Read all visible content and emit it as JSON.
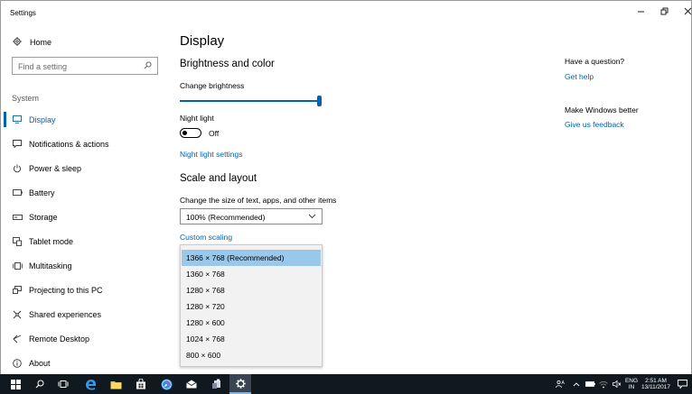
{
  "window": {
    "title": "Settings"
  },
  "sidebar": {
    "home_label": "Home",
    "search_placeholder": "Find a setting",
    "section_label": "System",
    "items": [
      {
        "label": "Display",
        "icon": "monitor-icon",
        "active": true
      },
      {
        "label": "Notifications & actions",
        "icon": "notification-icon"
      },
      {
        "label": "Power & sleep",
        "icon": "power-icon"
      },
      {
        "label": "Battery",
        "icon": "battery-icon"
      },
      {
        "label": "Storage",
        "icon": "storage-icon"
      },
      {
        "label": "Tablet mode",
        "icon": "tablet-mode-icon"
      },
      {
        "label": "Multitasking",
        "icon": "multitasking-icon"
      },
      {
        "label": "Projecting to this PC",
        "icon": "projecting-icon"
      },
      {
        "label": "Shared experiences",
        "icon": "shared-experiences-icon"
      },
      {
        "label": "Remote Desktop",
        "icon": "remote-desktop-icon"
      },
      {
        "label": "About",
        "icon": "info-icon"
      }
    ]
  },
  "main": {
    "title": "Display",
    "brightness": {
      "heading": "Brightness and color",
      "slider_label": "Change brightness",
      "brightness_level": 100,
      "night_light_label": "Night light",
      "night_light_state": "Off",
      "night_light_settings_link": "Night light settings"
    },
    "scale": {
      "heading": "Scale and layout",
      "size_label": "Change the size of text, apps, and other items",
      "size_value": "100% (Recommended)",
      "custom_scaling_link": "Custom scaling"
    },
    "resolution_dropdown": {
      "options": [
        "1366 × 768 (Recommended)",
        "1360 × 768",
        "1280 × 768",
        "1280 × 720",
        "1280 × 600",
        "1024 × 768",
        "800 × 600"
      ],
      "selected": "1366 × 768 (Recommended)"
    }
  },
  "aside": {
    "question_heading": "Have a question?",
    "get_help_link": "Get help",
    "feedback_heading": "Make Windows better",
    "feedback_link": "Give us feedback"
  },
  "taskbar": {
    "language_line1": "ENG",
    "language_line2": "IN",
    "time": "2:51 AM",
    "date": "13/11/2017"
  },
  "colors": {
    "accent": "#0063b1",
    "dropdown_selected": "#99c8ea",
    "taskbar": "#101820"
  }
}
